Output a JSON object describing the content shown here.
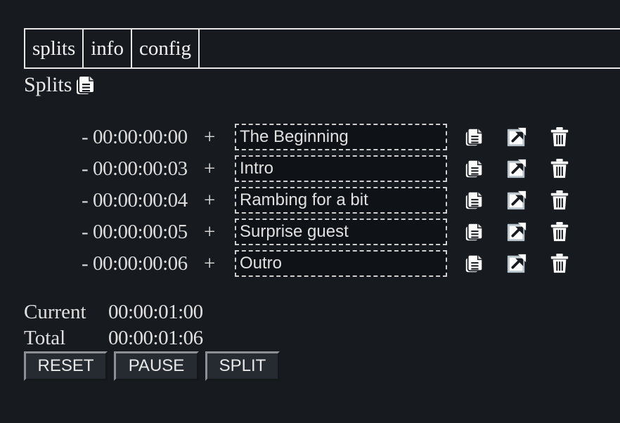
{
  "tabs": [
    {
      "label": "splits"
    },
    {
      "label": "info"
    },
    {
      "label": "config"
    }
  ],
  "section": {
    "title": "Splits",
    "copy_icon": "copy-icon"
  },
  "splits": [
    {
      "minus": "-",
      "time": "00:00:00:00",
      "plus": "+",
      "name": "The Beginning"
    },
    {
      "minus": "-",
      "time": "00:00:00:03",
      "plus": "+",
      "name": "Intro"
    },
    {
      "minus": "-",
      "time": "00:00:00:04",
      "plus": "+",
      "name": "Rambing for a bit"
    },
    {
      "minus": "-",
      "time": "00:00:00:05",
      "plus": "+",
      "name": "Surprise guest"
    },
    {
      "minus": "-",
      "time": "00:00:00:06",
      "plus": "+",
      "name": "Outro"
    }
  ],
  "row_icons": [
    "copy-icon",
    "external-edit-icon",
    "trash-icon"
  ],
  "stats": {
    "current_label": "Current",
    "current_value": "00:00:01:00",
    "total_label": "Total",
    "total_value": "00:00:01:06"
  },
  "buttons": {
    "reset": "RESET",
    "pause": "PAUSE",
    "split": "SPLIT"
  },
  "colors": {
    "background": "#171b20",
    "text": "#e4e4e4",
    "input_bg": "#0f1317",
    "button_bg": "#262b31"
  }
}
